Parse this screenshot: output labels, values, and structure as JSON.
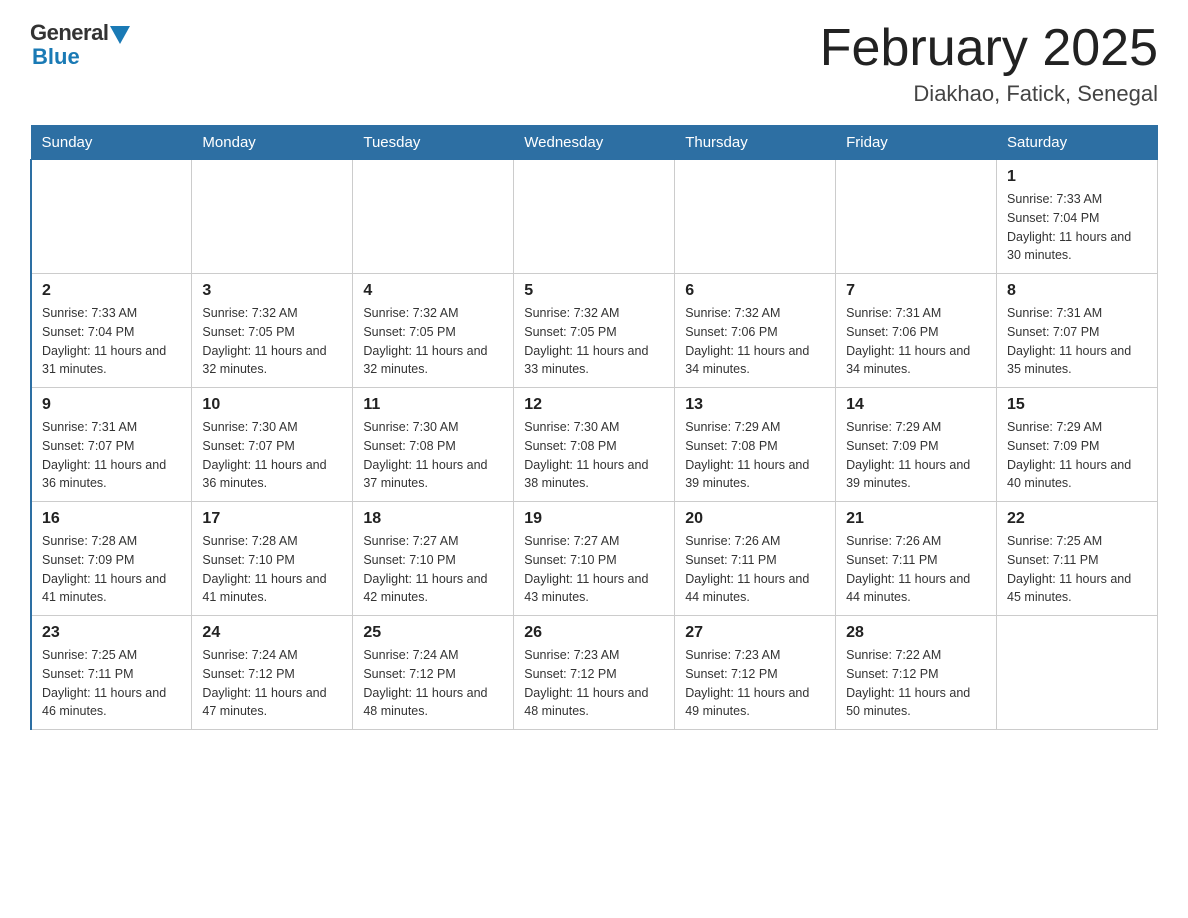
{
  "header": {
    "logo_general": "General",
    "logo_blue": "Blue",
    "month_title": "February 2025",
    "location": "Diakhao, Fatick, Senegal"
  },
  "weekdays": [
    "Sunday",
    "Monday",
    "Tuesday",
    "Wednesday",
    "Thursday",
    "Friday",
    "Saturday"
  ],
  "weeks": [
    [
      {
        "day": "",
        "sunrise": "",
        "sunset": "",
        "daylight": ""
      },
      {
        "day": "",
        "sunrise": "",
        "sunset": "",
        "daylight": ""
      },
      {
        "day": "",
        "sunrise": "",
        "sunset": "",
        "daylight": ""
      },
      {
        "day": "",
        "sunrise": "",
        "sunset": "",
        "daylight": ""
      },
      {
        "day": "",
        "sunrise": "",
        "sunset": "",
        "daylight": ""
      },
      {
        "day": "",
        "sunrise": "",
        "sunset": "",
        "daylight": ""
      },
      {
        "day": "1",
        "sunrise": "Sunrise: 7:33 AM",
        "sunset": "Sunset: 7:04 PM",
        "daylight": "Daylight: 11 hours and 30 minutes."
      }
    ],
    [
      {
        "day": "2",
        "sunrise": "Sunrise: 7:33 AM",
        "sunset": "Sunset: 7:04 PM",
        "daylight": "Daylight: 11 hours and 31 minutes."
      },
      {
        "day": "3",
        "sunrise": "Sunrise: 7:32 AM",
        "sunset": "Sunset: 7:05 PM",
        "daylight": "Daylight: 11 hours and 32 minutes."
      },
      {
        "day": "4",
        "sunrise": "Sunrise: 7:32 AM",
        "sunset": "Sunset: 7:05 PM",
        "daylight": "Daylight: 11 hours and 32 minutes."
      },
      {
        "day": "5",
        "sunrise": "Sunrise: 7:32 AM",
        "sunset": "Sunset: 7:05 PM",
        "daylight": "Daylight: 11 hours and 33 minutes."
      },
      {
        "day": "6",
        "sunrise": "Sunrise: 7:32 AM",
        "sunset": "Sunset: 7:06 PM",
        "daylight": "Daylight: 11 hours and 34 minutes."
      },
      {
        "day": "7",
        "sunrise": "Sunrise: 7:31 AM",
        "sunset": "Sunset: 7:06 PM",
        "daylight": "Daylight: 11 hours and 34 minutes."
      },
      {
        "day": "8",
        "sunrise": "Sunrise: 7:31 AM",
        "sunset": "Sunset: 7:07 PM",
        "daylight": "Daylight: 11 hours and 35 minutes."
      }
    ],
    [
      {
        "day": "9",
        "sunrise": "Sunrise: 7:31 AM",
        "sunset": "Sunset: 7:07 PM",
        "daylight": "Daylight: 11 hours and 36 minutes."
      },
      {
        "day": "10",
        "sunrise": "Sunrise: 7:30 AM",
        "sunset": "Sunset: 7:07 PM",
        "daylight": "Daylight: 11 hours and 36 minutes."
      },
      {
        "day": "11",
        "sunrise": "Sunrise: 7:30 AM",
        "sunset": "Sunset: 7:08 PM",
        "daylight": "Daylight: 11 hours and 37 minutes."
      },
      {
        "day": "12",
        "sunrise": "Sunrise: 7:30 AM",
        "sunset": "Sunset: 7:08 PM",
        "daylight": "Daylight: 11 hours and 38 minutes."
      },
      {
        "day": "13",
        "sunrise": "Sunrise: 7:29 AM",
        "sunset": "Sunset: 7:08 PM",
        "daylight": "Daylight: 11 hours and 39 minutes."
      },
      {
        "day": "14",
        "sunrise": "Sunrise: 7:29 AM",
        "sunset": "Sunset: 7:09 PM",
        "daylight": "Daylight: 11 hours and 39 minutes."
      },
      {
        "day": "15",
        "sunrise": "Sunrise: 7:29 AM",
        "sunset": "Sunset: 7:09 PM",
        "daylight": "Daylight: 11 hours and 40 minutes."
      }
    ],
    [
      {
        "day": "16",
        "sunrise": "Sunrise: 7:28 AM",
        "sunset": "Sunset: 7:09 PM",
        "daylight": "Daylight: 11 hours and 41 minutes."
      },
      {
        "day": "17",
        "sunrise": "Sunrise: 7:28 AM",
        "sunset": "Sunset: 7:10 PM",
        "daylight": "Daylight: 11 hours and 41 minutes."
      },
      {
        "day": "18",
        "sunrise": "Sunrise: 7:27 AM",
        "sunset": "Sunset: 7:10 PM",
        "daylight": "Daylight: 11 hours and 42 minutes."
      },
      {
        "day": "19",
        "sunrise": "Sunrise: 7:27 AM",
        "sunset": "Sunset: 7:10 PM",
        "daylight": "Daylight: 11 hours and 43 minutes."
      },
      {
        "day": "20",
        "sunrise": "Sunrise: 7:26 AM",
        "sunset": "Sunset: 7:11 PM",
        "daylight": "Daylight: 11 hours and 44 minutes."
      },
      {
        "day": "21",
        "sunrise": "Sunrise: 7:26 AM",
        "sunset": "Sunset: 7:11 PM",
        "daylight": "Daylight: 11 hours and 44 minutes."
      },
      {
        "day": "22",
        "sunrise": "Sunrise: 7:25 AM",
        "sunset": "Sunset: 7:11 PM",
        "daylight": "Daylight: 11 hours and 45 minutes."
      }
    ],
    [
      {
        "day": "23",
        "sunrise": "Sunrise: 7:25 AM",
        "sunset": "Sunset: 7:11 PM",
        "daylight": "Daylight: 11 hours and 46 minutes."
      },
      {
        "day": "24",
        "sunrise": "Sunrise: 7:24 AM",
        "sunset": "Sunset: 7:12 PM",
        "daylight": "Daylight: 11 hours and 47 minutes."
      },
      {
        "day": "25",
        "sunrise": "Sunrise: 7:24 AM",
        "sunset": "Sunset: 7:12 PM",
        "daylight": "Daylight: 11 hours and 48 minutes."
      },
      {
        "day": "26",
        "sunrise": "Sunrise: 7:23 AM",
        "sunset": "Sunset: 7:12 PM",
        "daylight": "Daylight: 11 hours and 48 minutes."
      },
      {
        "day": "27",
        "sunrise": "Sunrise: 7:23 AM",
        "sunset": "Sunset: 7:12 PM",
        "daylight": "Daylight: 11 hours and 49 minutes."
      },
      {
        "day": "28",
        "sunrise": "Sunrise: 7:22 AM",
        "sunset": "Sunset: 7:12 PM",
        "daylight": "Daylight: 11 hours and 50 minutes."
      },
      {
        "day": "",
        "sunrise": "",
        "sunset": "",
        "daylight": ""
      }
    ]
  ]
}
